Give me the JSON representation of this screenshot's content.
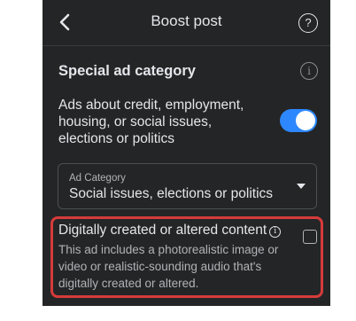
{
  "header": {
    "title": "Boost post",
    "back_icon": "chevron-left-icon",
    "help_label": "?"
  },
  "special_ad_category": {
    "title": "Special ad category",
    "info_icon": "info-icon",
    "info_glyph": "i",
    "toggle_text": "Ads about credit, employment, housing, or social issues, elections or politics",
    "toggle_on": true
  },
  "ad_category_select": {
    "label": "Ad Category",
    "value": "Social issues, elections or politics"
  },
  "altered_content": {
    "title": "Digitally created or altered content",
    "info_glyph": "i",
    "description": "This ad includes a photorealistic image or video or realistic-sounding audio that's digitally created or altered.",
    "checked": false
  },
  "colors": {
    "background": "#242526",
    "accent": "#2d88ff",
    "highlight": "#d63b3b"
  }
}
